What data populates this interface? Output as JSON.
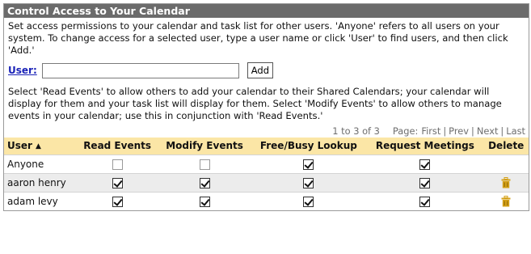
{
  "panel": {
    "title": "Control Access to Your Calendar",
    "intro": "Set access permissions to your calendar and task list for other users. 'Anyone' refers to all users on your system. To change access for a selected user, type a user name or click 'User' to find users, and then click 'Add.'",
    "help": "Select 'Read Events' to allow others to add your calendar to their Shared Calendars; your calendar will display for them and your task list will display for them. Select 'Modify Events' to allow others to manage events in your calendar; use this in conjunction with 'Read Events.'"
  },
  "user_field": {
    "link_label": "User:",
    "value": "",
    "add_label": "Add"
  },
  "pager": {
    "count": "1 to 3 of 3",
    "page_label": "Page:",
    "first": "First",
    "prev": "Prev",
    "next": "Next",
    "last": "Last"
  },
  "table": {
    "columns": [
      "User",
      "Read Events",
      "Modify Events",
      "Free/Busy Lookup",
      "Request Meetings",
      "Delete"
    ],
    "sort_icon": "sort-ascending-icon",
    "rows": [
      {
        "name": "Anyone",
        "read": false,
        "modify": false,
        "freebusy": true,
        "request": true,
        "deletable": false
      },
      {
        "name": "aaron henry",
        "read": true,
        "modify": true,
        "freebusy": true,
        "request": true,
        "deletable": true
      },
      {
        "name": "adam levy",
        "read": true,
        "modify": true,
        "freebusy": true,
        "request": true,
        "deletable": true
      }
    ]
  },
  "colors": {
    "header_bg": "#6b6b6b",
    "table_header_bg": "#fbe6a6",
    "alt_row_bg": "#ececec",
    "link": "#1b23b8",
    "trash": "#d4a017"
  }
}
